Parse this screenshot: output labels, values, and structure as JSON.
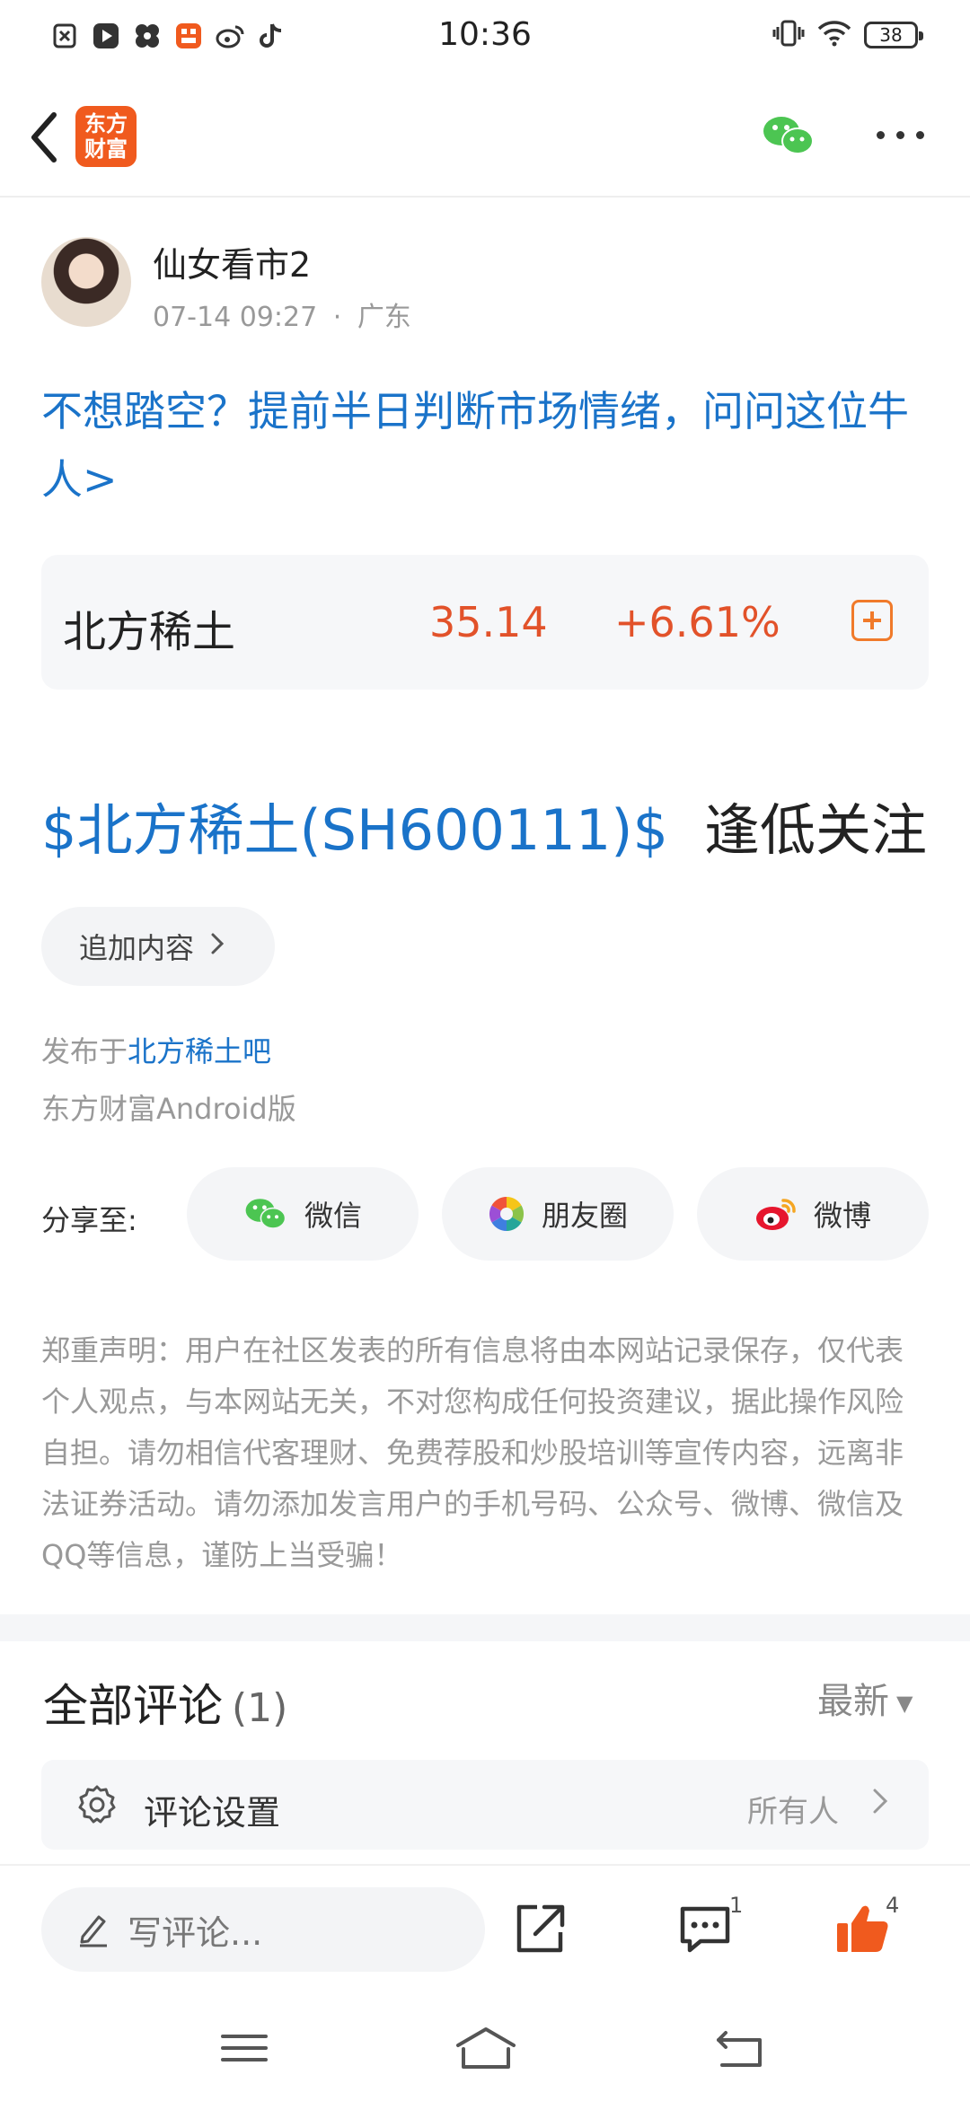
{
  "status_bar": {
    "time": "10:36",
    "battery": "38",
    "left_icons": [
      "notification-x-icon",
      "video-play-icon",
      "pinwheel-icon",
      "app-orange-icon",
      "weibo-icon",
      "tiktok-icon"
    ],
    "right_icons": [
      "vibrate-icon",
      "wifi-icon",
      "battery-icon"
    ]
  },
  "nav": {
    "logo_text_line1": "东方",
    "logo_text_line2": "财富",
    "brand_color": "#f05a1e"
  },
  "author": {
    "name": "仙女看市2",
    "time": "07-14 09:27",
    "separator": "·",
    "location": "广东"
  },
  "promo_text": "不想踏空？提前半日判断市场情绪，问问这位牛人>",
  "stock": {
    "name": "北方稀土",
    "price": "35.14",
    "change": "+6.61%",
    "color_up": "#e2522a"
  },
  "post": {
    "stock_link": "$北方稀土(SH600111)$",
    "text": "逢低关注"
  },
  "add_content_label": "追加内容",
  "published": {
    "prefix": "发布于",
    "bar": "北方稀土吧",
    "client": "东方财富Android版"
  },
  "share": {
    "label": "分享至:",
    "wechat": "微信",
    "moments": "朋友圈",
    "weibo": "微博"
  },
  "disclaimer": "郑重声明：用户在社区发表的所有信息将由本网站记录保存，仅代表个人观点，与本网站无关，不对您构成任何投资建议，据此操作风险自担。请勿相信代客理财、免费荐股和炒股培训等宣传内容，远离非法证券活动。请勿添加发言用户的手机号码、公众号、微博、微信及QQ等信息，谨防上当受骗！",
  "comments": {
    "title": "全部评论",
    "count": "(1)",
    "sort": "最新",
    "setting_label": "评论设置",
    "setting_value": "所有人"
  },
  "bottom_bar": {
    "write_placeholder": "写评论...",
    "comment_count": "1",
    "like_count": "4"
  }
}
